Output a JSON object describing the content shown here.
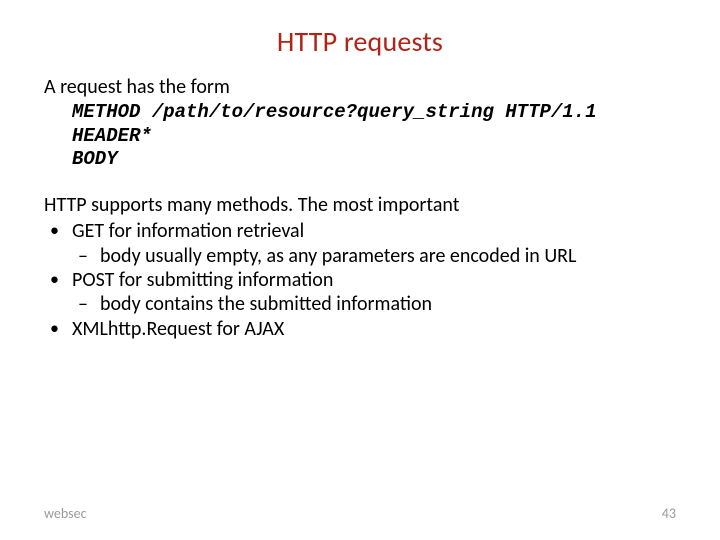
{
  "title": "HTTP requests",
  "intro": "A request has the form",
  "code": {
    "line1": "METHOD /path/to/resource?query_string HTTP/1.1",
    "line2": "HEADER*",
    "line3": "BODY"
  },
  "lead": "HTTP supports many methods. The most important",
  "bullets": {
    "b1": "GET for information retrieval",
    "b1s1": "body usually empty, as any parameters are encoded in URL",
    "b2": "POST for submitting information",
    "b2s1": "body contains the submitted information",
    "b3": "XMLhttp.Request for AJAX"
  },
  "footer": {
    "left": "websec",
    "page": "43"
  }
}
